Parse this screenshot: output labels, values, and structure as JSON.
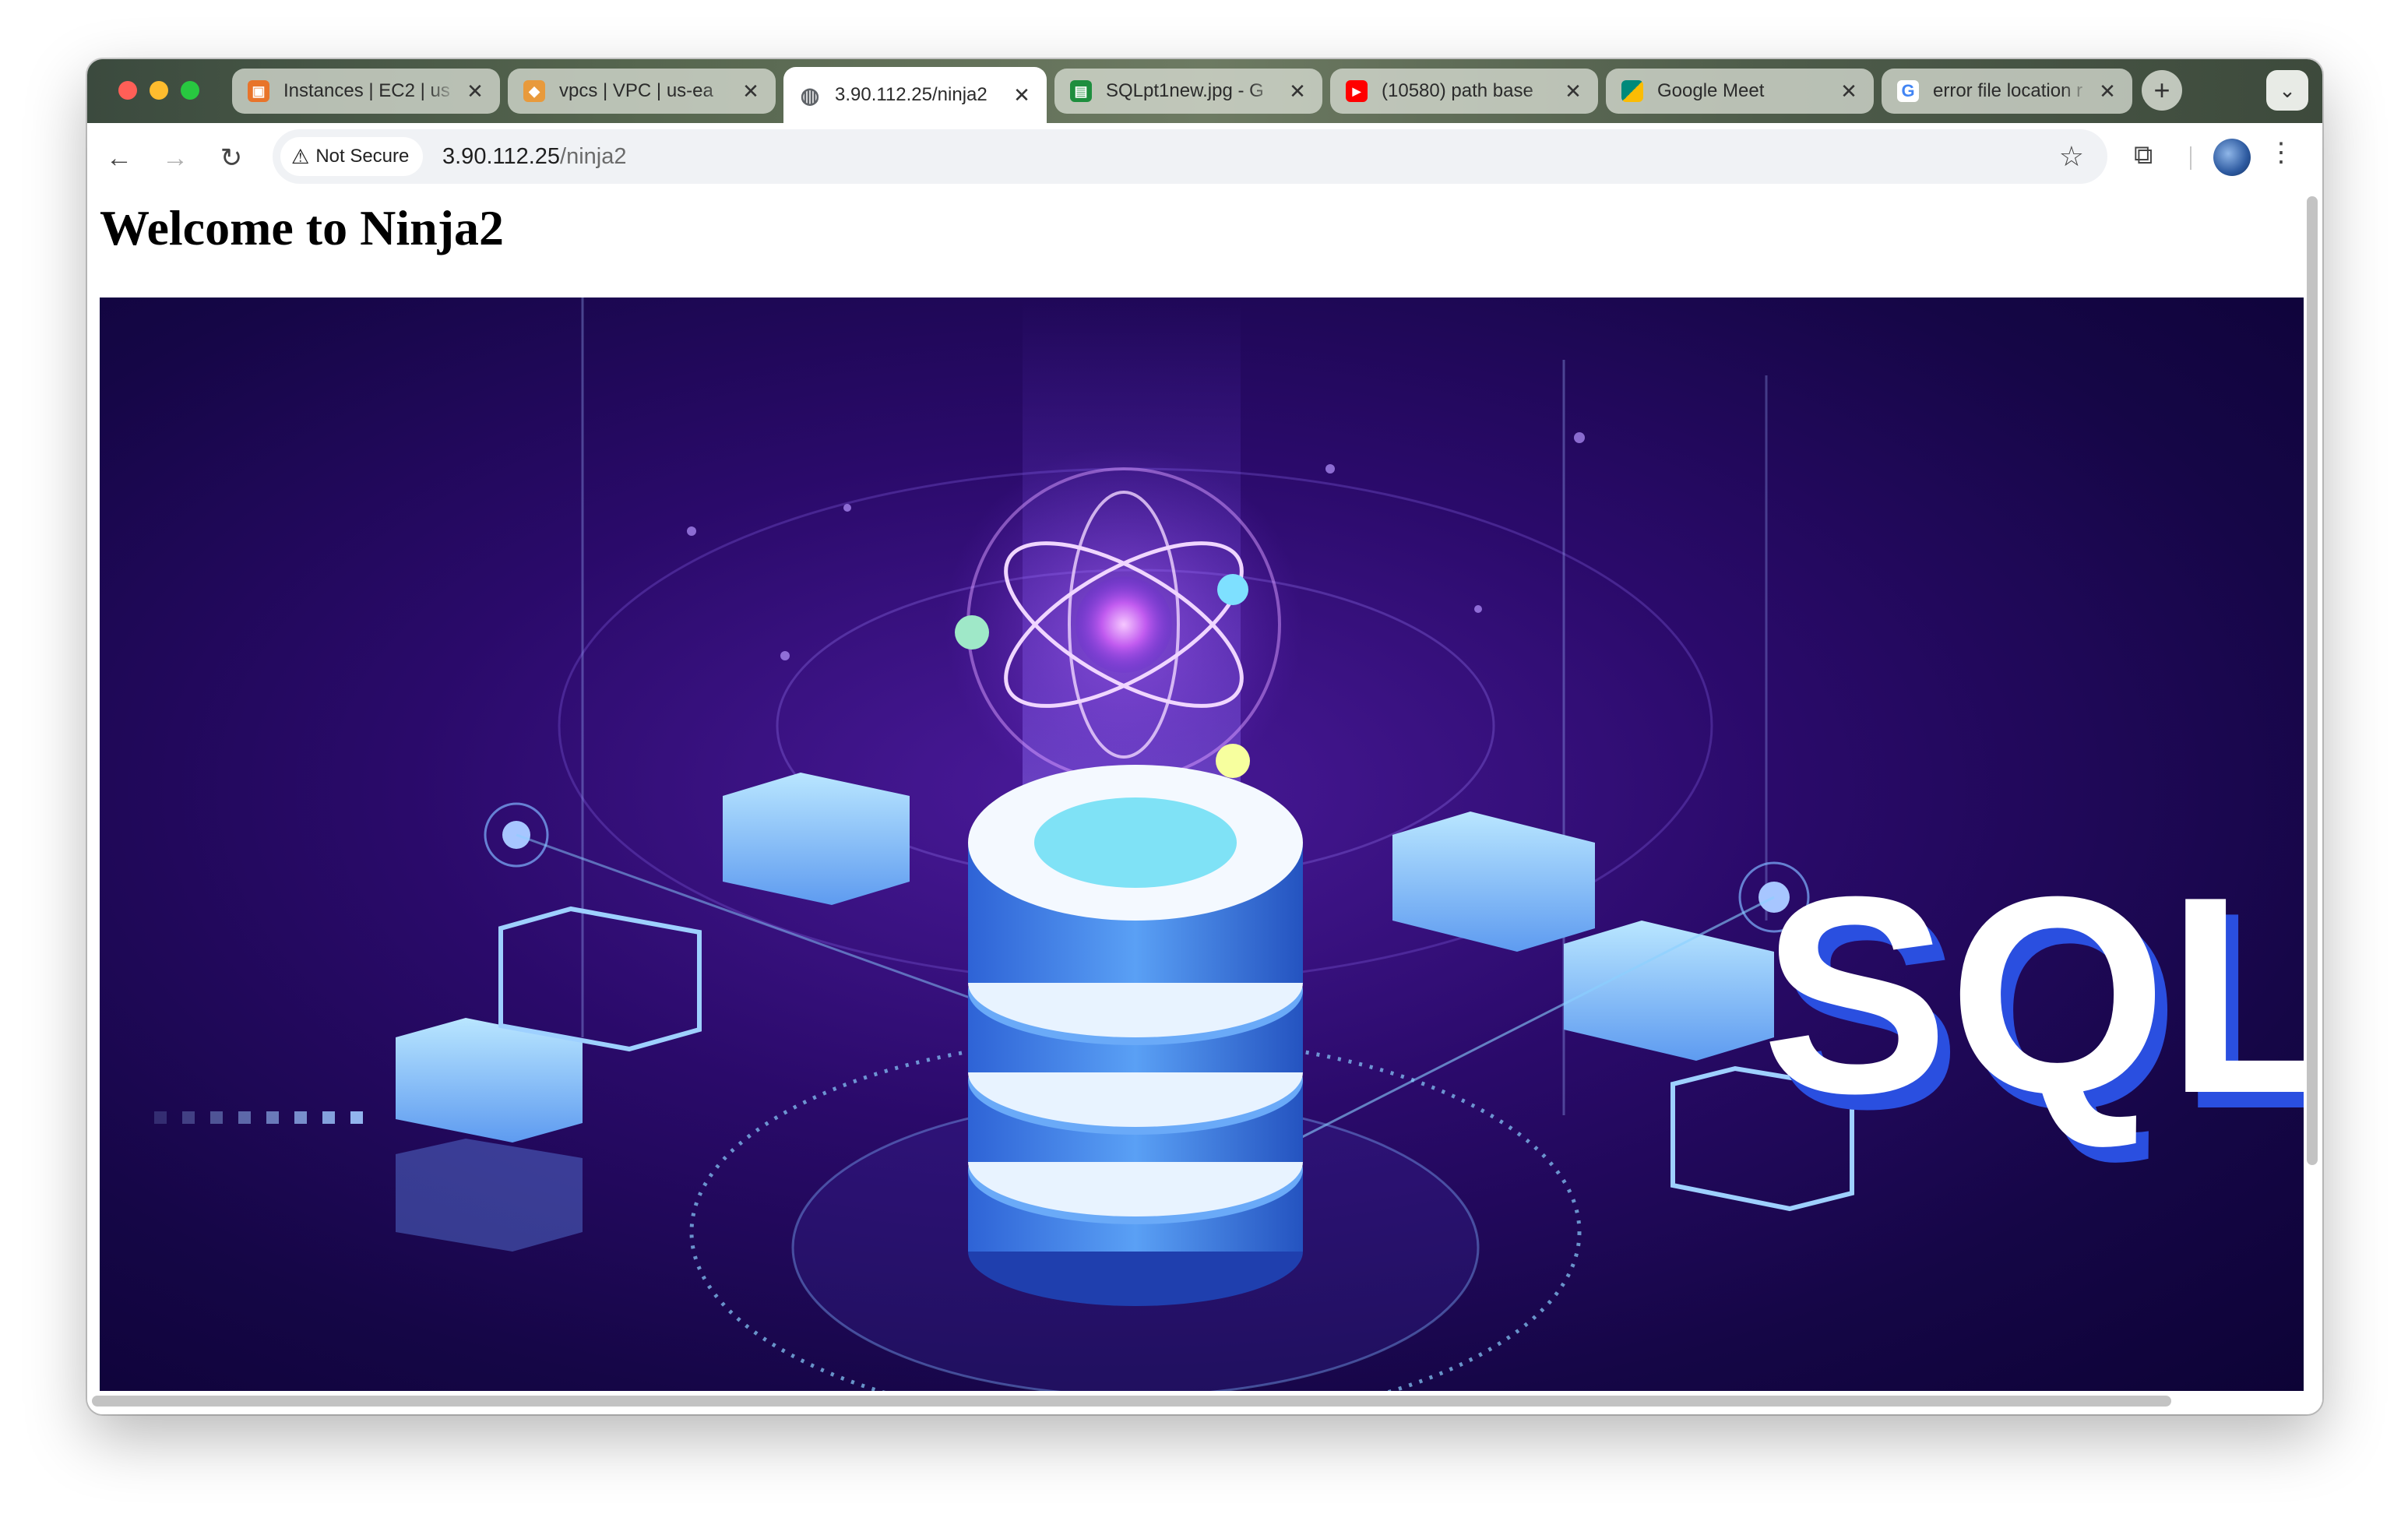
{
  "browser": {
    "tabs": [
      {
        "title": "Instances | EC2 | us",
        "icon": "aws-ec2-icon",
        "color": "#e8742a",
        "active": false
      },
      {
        "title": "vpcs | VPC | us-ea",
        "icon": "aws-vpc-icon",
        "color": "#e89a3c",
        "active": false
      },
      {
        "title": "3.90.112.25/ninja2",
        "icon": "globe-icon",
        "color": "#5f6368",
        "active": true
      },
      {
        "title": "SQLpt1new.jpg - G",
        "icon": "drive-file-icon",
        "color": "#1e8e3e",
        "active": false
      },
      {
        "title": "(10580) path base",
        "icon": "youtube-icon",
        "color": "#ff0000",
        "active": false
      },
      {
        "title": "Google Meet",
        "icon": "google-meet-icon",
        "color": "#00897b",
        "active": false
      },
      {
        "title": "error file location r",
        "icon": "google-icon",
        "color": "#4285f4",
        "active": false
      }
    ],
    "security_label": "Not Secure",
    "url_host": "3.90.112.25",
    "url_path": "/ninja2"
  },
  "page": {
    "heading": "Welcome to Ninja2",
    "hero_text": "SQL"
  }
}
